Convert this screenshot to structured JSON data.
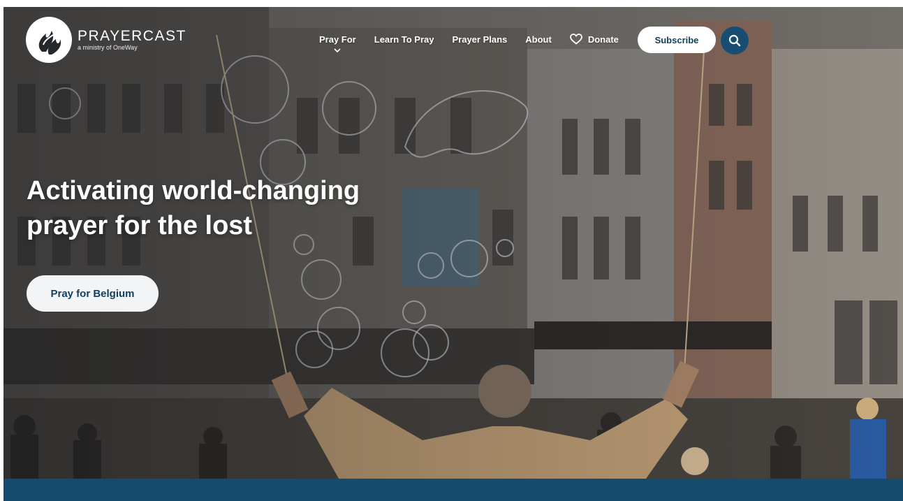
{
  "brand": {
    "name": "PRAYERCAST",
    "tagline": "a ministry of OneWay"
  },
  "nav": {
    "items": [
      {
        "label": "Pray For",
        "has_dropdown": true
      },
      {
        "label": "Learn To Pray"
      },
      {
        "label": "Prayer Plans"
      },
      {
        "label": "About"
      },
      {
        "label": "Donate",
        "icon": "heart-icon"
      }
    ],
    "subscribe_label": "Subscribe",
    "search_icon": "search-icon"
  },
  "hero": {
    "headline_line1": "Activating world-changing",
    "headline_line2": "prayer for the lost",
    "cta_label": "Pray for Belgium"
  },
  "colors": {
    "brand_navy": "#154b6e",
    "button_text": "#123f5e",
    "search_bg": "#174d72"
  }
}
